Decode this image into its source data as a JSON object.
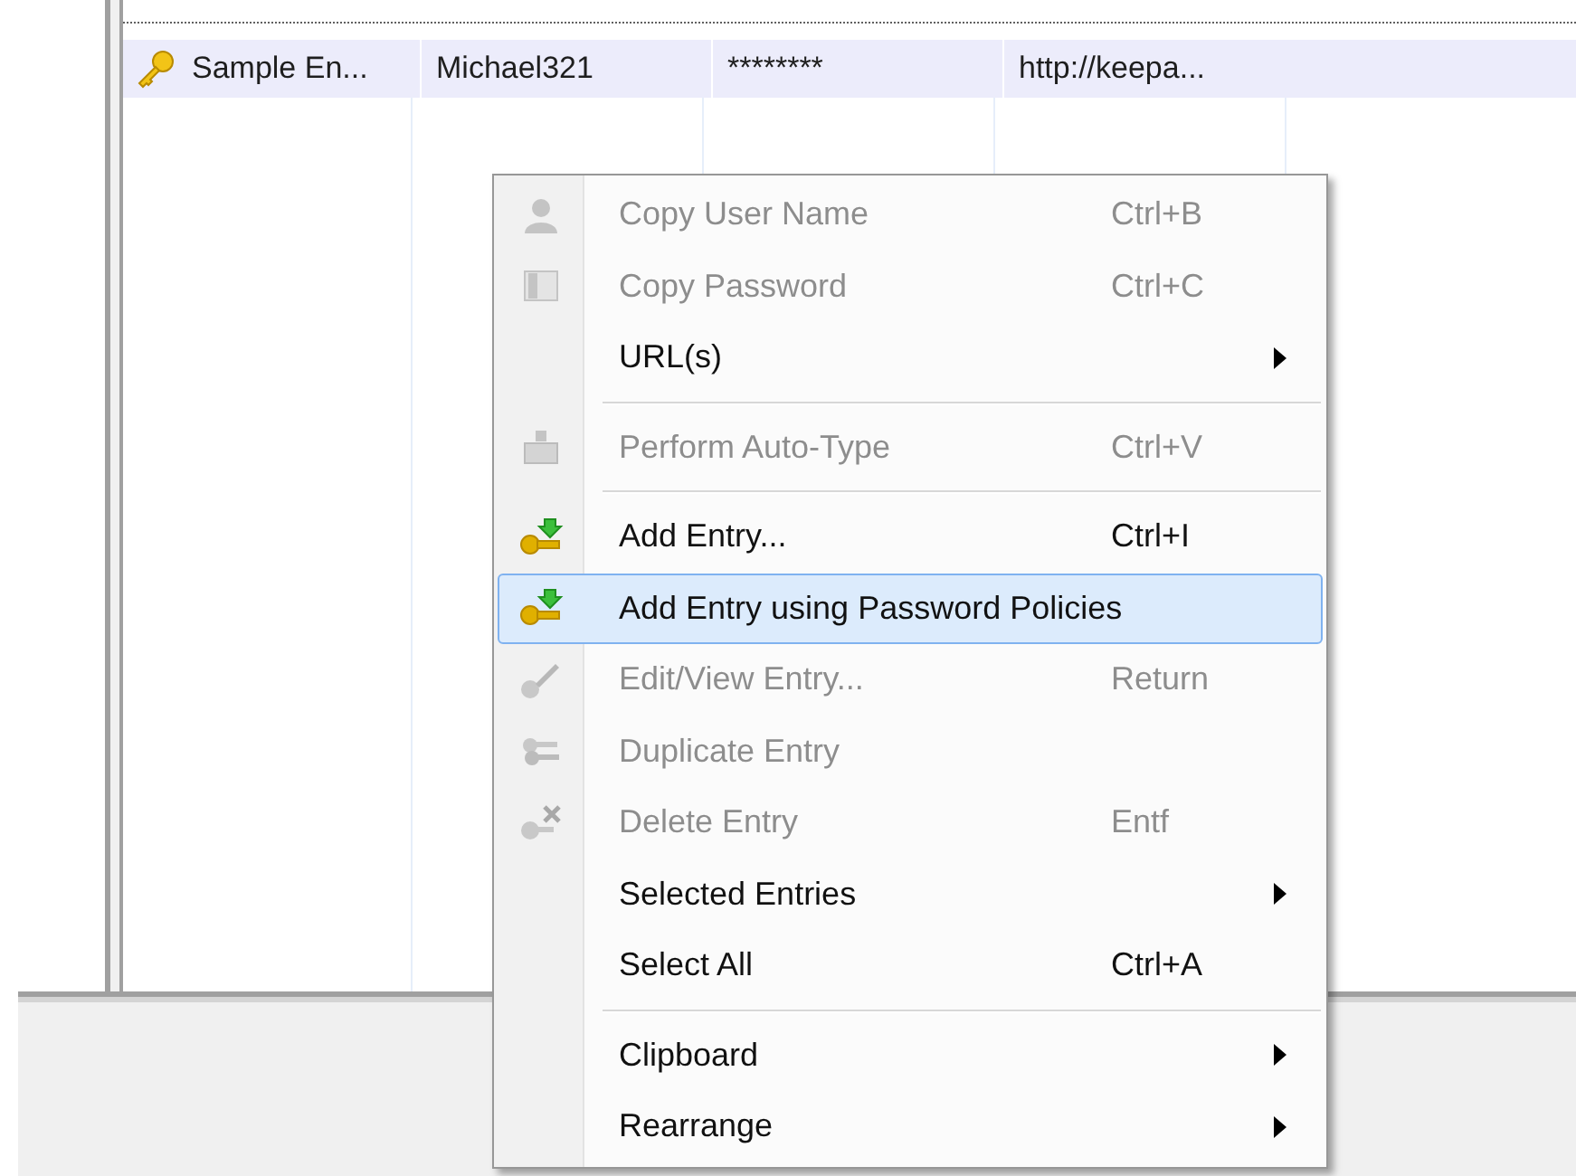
{
  "entries": {
    "rows": [
      {
        "selected": true,
        "cells": [
          "Sample En...",
          "Michael321",
          "********",
          "http://keepa..."
        ]
      }
    ]
  },
  "context_menu": {
    "items": [
      {
        "kind": "item",
        "label": "Copy User Name",
        "shortcut": "Ctrl+B",
        "disabled": true,
        "submenu": false,
        "selected": false
      },
      {
        "kind": "item",
        "label": "Copy Password",
        "shortcut": "Ctrl+C",
        "disabled": true,
        "submenu": false,
        "selected": false
      },
      {
        "kind": "item",
        "label": "URL(s)",
        "disabled": false,
        "submenu": true,
        "selected": false
      },
      {
        "kind": "separator"
      },
      {
        "kind": "item",
        "label": "Perform Auto-Type",
        "shortcut": "Ctrl+V",
        "disabled": true,
        "submenu": false,
        "selected": false
      },
      {
        "kind": "separator"
      },
      {
        "kind": "item",
        "label": "Add Entry...",
        "shortcut": "Ctrl+I",
        "disabled": false,
        "submenu": false,
        "selected": false
      },
      {
        "kind": "item",
        "label": "Add Entry using Password Policies",
        "disabled": false,
        "submenu": false,
        "selected": true
      },
      {
        "kind": "item",
        "label": "Edit/View Entry...",
        "shortcut": "Return",
        "disabled": true,
        "submenu": false,
        "selected": false
      },
      {
        "kind": "item",
        "label": "Duplicate Entry",
        "disabled": true,
        "submenu": false,
        "selected": false
      },
      {
        "kind": "item",
        "label": "Delete Entry",
        "shortcut": "Entf",
        "disabled": true,
        "submenu": false,
        "selected": false
      },
      {
        "kind": "item",
        "label": "Selected Entries",
        "disabled": false,
        "submenu": true,
        "selected": false
      },
      {
        "kind": "item",
        "label": "Select All",
        "shortcut": "Ctrl+A",
        "disabled": false,
        "submenu": false,
        "selected": false
      },
      {
        "kind": "separator"
      },
      {
        "kind": "item",
        "label": "Clipboard",
        "disabled": false,
        "submenu": true,
        "selected": false
      },
      {
        "kind": "item",
        "label": "Rearrange",
        "disabled": false,
        "submenu": true,
        "selected": false
      }
    ]
  }
}
